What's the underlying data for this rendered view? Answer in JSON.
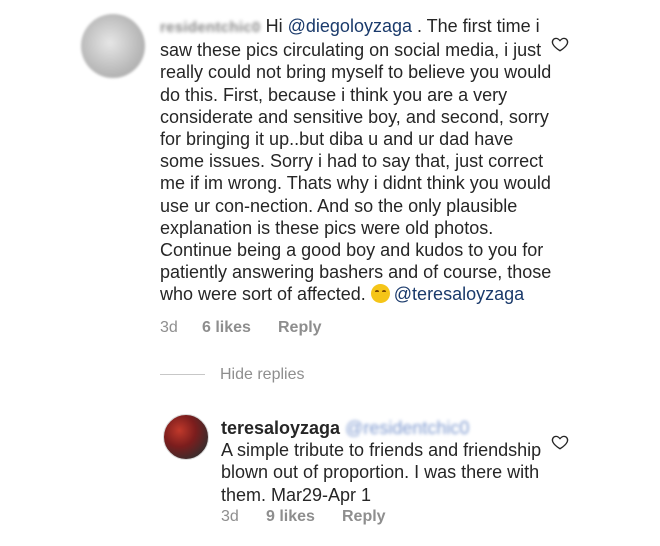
{
  "comment": {
    "username": "residentchic0",
    "greeting": "Hi ",
    "mention": "@diegoloyzaga",
    "body": " . The first time i saw these pics circulating on social media, i just really could not bring myself to believe you would do this. First, because i think you are a very considerate and sensitive boy, and second, sorry for bringing it up..but diba u and ur dad have some issues. Sorry i had to say that, just correct me if im wrong. Thats why i didnt think you would use ur con-nection. And so the only plausible explanation is these pics were old photos. Continue being a good boy and kudos to you for patiently answering bashers and of course, those who were sort of affected. ",
    "emoji": "smiling-face-emoji",
    "end_mention": "@teresaloyzaga",
    "time": "3d",
    "likes": "6 likes",
    "reply_label": "Reply"
  },
  "hide_replies_label": "Hide replies",
  "reply": {
    "username": "teresaloyzaga",
    "mention": "@residentchic0",
    "body": "A simple tribute to friends and friendship blown out of proportion. I was there with them. Mar29-Apr 1",
    "time": "3d",
    "likes": "9 likes",
    "reply_label": "Reply"
  },
  "icons": {
    "heart": "heart-outline-icon"
  },
  "colors": {
    "text": "#262626",
    "meta": "#8e8e8e",
    "mention": "#1a3a6b"
  }
}
